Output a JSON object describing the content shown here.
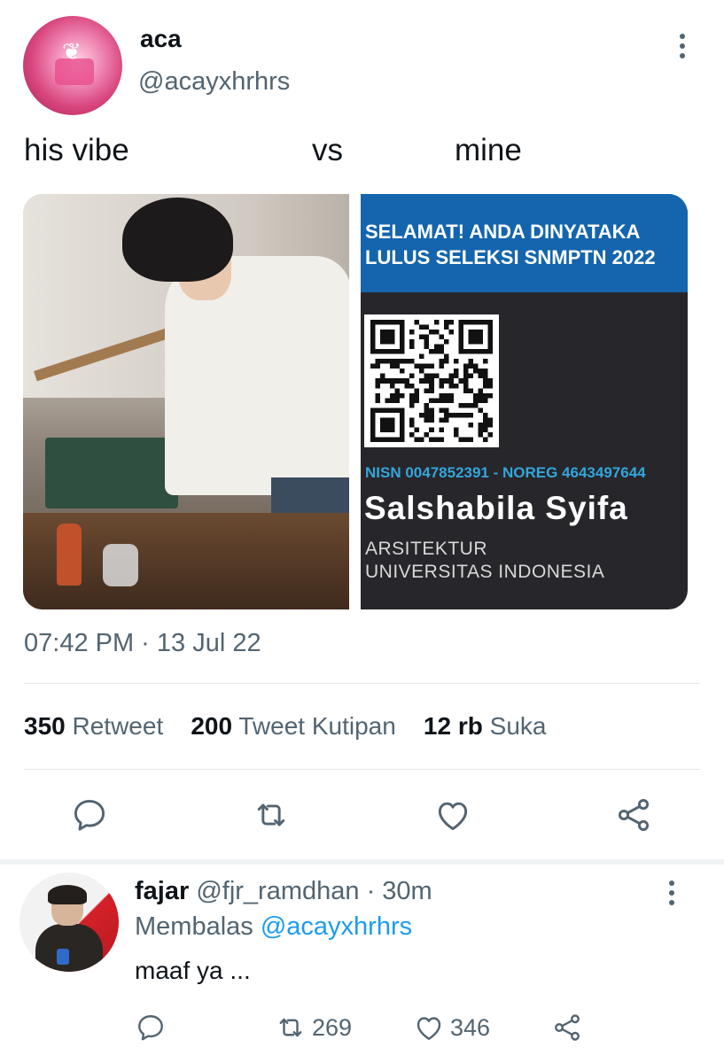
{
  "tweet": {
    "author": {
      "name": "aca",
      "handle": "@acayxhrhrs"
    },
    "text_parts": [
      "his vibe",
      "vs",
      "mine"
    ],
    "media": {
      "card": {
        "banner_line1": "SELAMAT! ANDA DINYATAKA",
        "banner_line2": "LULUS SELEKSI SNMPTN 2022",
        "nisn_noreg": "NISN 0047852391 - NOREG 4643497644",
        "student_name": "Salshabila Syifa",
        "major": "ARSITEKTUR",
        "university": "UNIVERSITAS INDONESIA"
      }
    },
    "timestamp": "07:42 PM · 13 Jul 22",
    "stats": {
      "retweets_count": "350",
      "retweets_label": "Retweet",
      "quotes_count": "200",
      "quotes_label": "Tweet Kutipan",
      "likes_count": "12 rb",
      "likes_label": "Suka"
    },
    "actions": [
      "reply-icon",
      "retweet-icon",
      "like-icon",
      "share-icon"
    ]
  },
  "reply": {
    "name": "fajar",
    "handle": "@fjr_ramdhan",
    "time": "· 30m",
    "replying_label": "Membalas",
    "replying_to": "@acayxhrhrs",
    "text": "maaf ya ...",
    "retweets": "269",
    "likes": "346"
  },
  "colors": {
    "text": "#0f1419",
    "secondary": "#536471",
    "link": "#1d9bf0",
    "card_banner": "#1465ad",
    "card_bg": "#26262b",
    "nisn": "#34a6db"
  }
}
